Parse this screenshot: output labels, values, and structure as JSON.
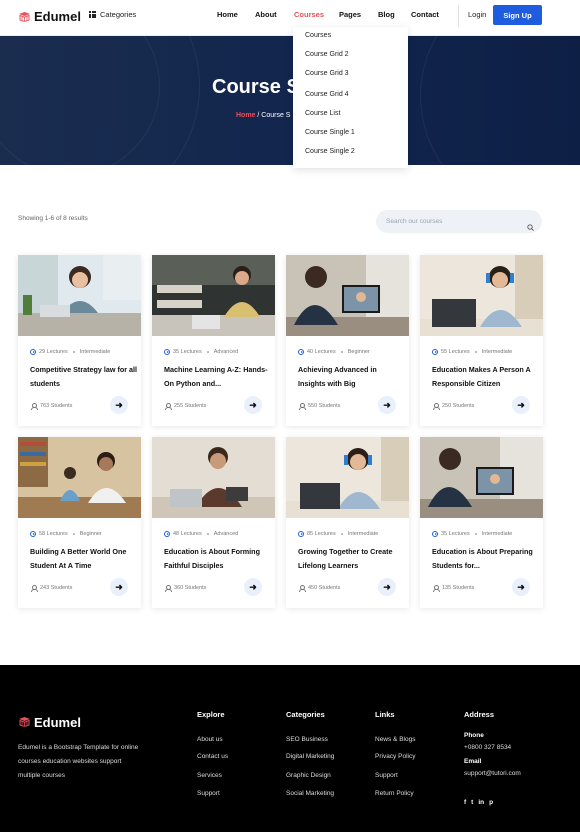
{
  "header": {
    "brand": "Edumel",
    "categories_label": "Categories",
    "nav": [
      "Home",
      "About",
      "Courses",
      "Pages",
      "Blog",
      "Contact"
    ],
    "active_nav": "Courses",
    "login": "Login",
    "signup": "Sign Up"
  },
  "hero": {
    "title": "Course S",
    "breadcrumb_home": "Home",
    "breadcrumb_current": "/ Course S"
  },
  "dropdown": {
    "items": [
      "Courses",
      "Course Grid 2",
      "Course Grid 3",
      "Course Grid 4",
      "Course List",
      "Course Single 1",
      "Course Single 2"
    ]
  },
  "toolbar": {
    "results": "Showing 1-6 of 8 results",
    "search_placeholder": "Search our courses"
  },
  "courses": [
    {
      "lectures": "29 Lectures",
      "level": "Intermediate",
      "title": "Competitive Strategy law for all students",
      "students": "763 Students"
    },
    {
      "lectures": "35 Lectures",
      "level": "Advanced",
      "title": "Machine Learning A-Z: Hands-On Python and...",
      "students": "255 Students"
    },
    {
      "lectures": "40 Lectures",
      "level": "Beginner",
      "title": "Achieving Advanced in Insights with Big",
      "students": "550 Students"
    },
    {
      "lectures": "55 Lectures",
      "level": "Intermediate",
      "title": "Education Makes A Person A Responsible Citizen",
      "students": "250 Students"
    },
    {
      "lectures": "58 Lectures",
      "level": "Beginner",
      "title": "Building A Better World One Student At A Time",
      "students": "243 Students"
    },
    {
      "lectures": "48 Lectures",
      "level": "Advanced",
      "title": "Education is About Forming Faithful Disciples",
      "students": "360 Students"
    },
    {
      "lectures": "85 Lectures",
      "level": "Intermediate",
      "title": "Growing Together to Create Lifelong Learners",
      "students": "450 Students"
    },
    {
      "lectures": "35 Lectures",
      "level": "Intermediate",
      "title": "Education is About Preparing Students for...",
      "students": "135 Students"
    }
  ],
  "footer": {
    "brand": "Edumel",
    "description": "Edumel is a Bootstrap Template for online courses education websites support multiple courses",
    "explore": {
      "heading": "Explore",
      "links": [
        "About us",
        "Contact us",
        "Services",
        "Support"
      ]
    },
    "categories": {
      "heading": "Categories",
      "links": [
        "SEO Business",
        "Digital Marketing",
        "Graphic Design",
        "Social Marketing"
      ]
    },
    "links": {
      "heading": "Links",
      "links": [
        "News & Blogs",
        "Privacy Policy",
        "Support",
        "Return Policy"
      ]
    },
    "address": {
      "heading": "Address",
      "phone_label": "Phone",
      "phone": "+0800 327 8534",
      "email_label": "Email",
      "email": "support@tutori.com"
    },
    "social": [
      "f",
      "t",
      "in",
      "p"
    ]
  },
  "colors": {
    "accent": "#e8505b",
    "primary": "#1f5de0",
    "hero_bg": "#12264e",
    "footer_bg": "#000000"
  }
}
